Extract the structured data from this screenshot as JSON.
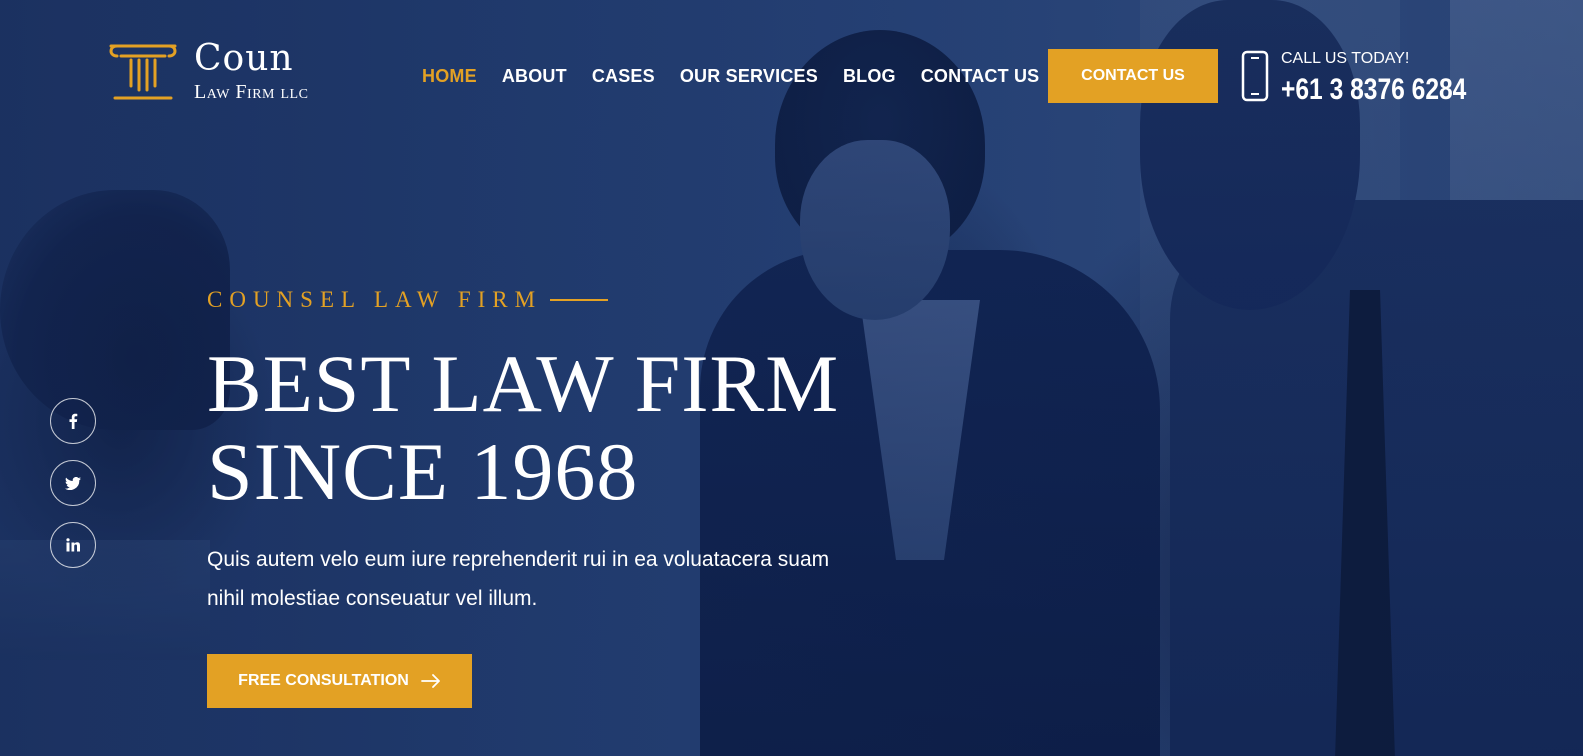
{
  "brand": {
    "name": "Coun",
    "sub": "Law Firm llc",
    "accent_color": "#e3a124",
    "icon": "column-pillar-icon"
  },
  "nav": {
    "items": [
      {
        "label": "HOME",
        "active": true
      },
      {
        "label": "ABOUT",
        "active": false
      },
      {
        "label": "CASES",
        "active": false
      },
      {
        "label": "OUR SERVICES",
        "active": false
      },
      {
        "label": "BLOG",
        "active": false
      },
      {
        "label": "CONTACT US",
        "active": false
      }
    ]
  },
  "header": {
    "cta_label": "CONTACT US",
    "phone_label": "CALL US TODAY!",
    "phone_number": "+61 3 8376 6284",
    "phone_icon": "smartphone-icon"
  },
  "socials": [
    {
      "name": "facebook-icon",
      "glyph": "f"
    },
    {
      "name": "twitter-icon",
      "glyph": "t"
    },
    {
      "name": "linkedin-icon",
      "glyph": "in"
    }
  ],
  "hero": {
    "eyebrow": "COUNSEL LAW FIRM",
    "headline_line1": "BEST LAW FIRM",
    "headline_line2": "SINCE 1968",
    "description": "Quis autem velo eum iure reprehenderit rui in ea voluatacera suam nihil molestiae conseuatur vel illum.",
    "cta_label": "FREE CONSULTATION",
    "cta_icon": "arrow-right-icon"
  }
}
